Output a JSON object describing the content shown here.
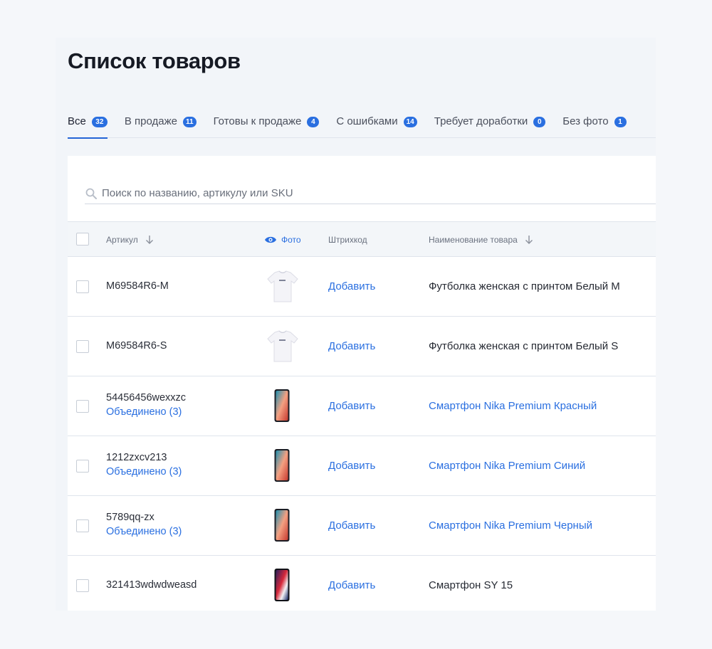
{
  "page": {
    "title": "Список товаров"
  },
  "tabs": [
    {
      "label": "Все",
      "count": "32",
      "active": true
    },
    {
      "label": "В продаже",
      "count": "11"
    },
    {
      "label": "Готовы к продаже",
      "count": "4"
    },
    {
      "label": "С ошибками",
      "count": "14"
    },
    {
      "label": "Требует доработки",
      "count": "0"
    },
    {
      "label": "Без фото",
      "count": "1"
    }
  ],
  "search": {
    "placeholder": "Поиск по названию, артикулу или SKU",
    "value": ""
  },
  "columns": {
    "sku": "Артикул",
    "photo": "Фото",
    "barcode": "Штрихкод",
    "name": "Наименование товара"
  },
  "rows": [
    {
      "sku": "M69584R6-M",
      "merged": "",
      "thumb": "tshirt",
      "barcode_action": "Добавить",
      "name": "Футболка женская с принтом Белый M",
      "name_link": false
    },
    {
      "sku": "M69584R6-S",
      "merged": "",
      "thumb": "tshirt",
      "barcode_action": "Добавить",
      "name": "Футболка женская с принтом Белый S",
      "name_link": false
    },
    {
      "sku": "54456456wexxzc",
      "merged": "Объединено (3)",
      "thumb": "phone-gradient",
      "barcode_action": "Добавить",
      "name": "Смартфон Nika Premium Красный",
      "name_link": true
    },
    {
      "sku": "1212zxcv213",
      "merged": "Объединено (3)",
      "thumb": "phone-gradient",
      "barcode_action": "Добавить",
      "name": "Смартфон Nika Premium Синий",
      "name_link": true
    },
    {
      "sku": "5789qq-zx",
      "merged": "Объединено (3)",
      "thumb": "phone-gradient",
      "barcode_action": "Добавить",
      "name": "Смартфон Nika Premium Черный",
      "name_link": true
    },
    {
      "sku": "321413wdwdweasd",
      "merged": "",
      "thumb": "phone-dark",
      "barcode_action": "Добавить",
      "name": "Смартфон SY 15",
      "name_link": false
    }
  ],
  "colors": {
    "accent": "#2a6fe0",
    "background": "#f5f7fa",
    "panel": "#f2f5f9"
  }
}
